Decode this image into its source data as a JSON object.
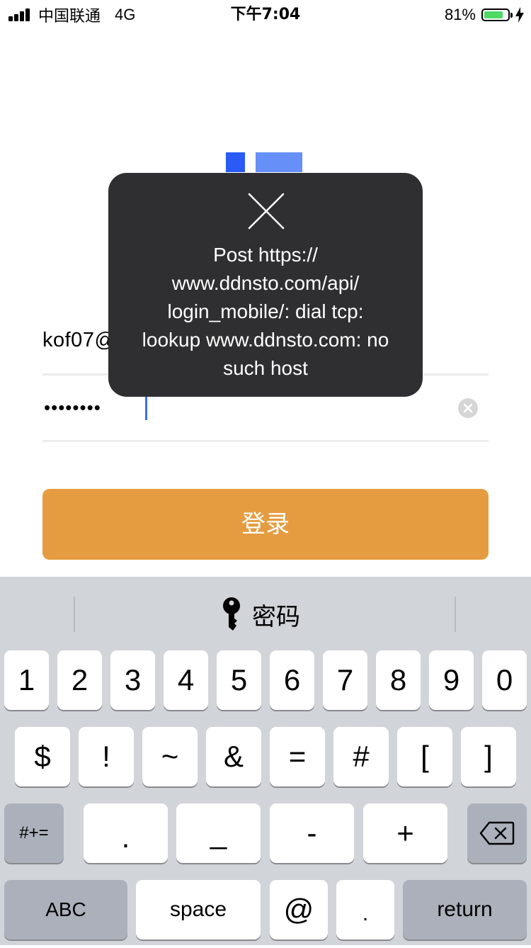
{
  "status_bar": {
    "carrier": "中国联通",
    "network": "4G",
    "time": "下午7:04",
    "battery_percent": "81%",
    "battery_level": 0.81
  },
  "form": {
    "email_value": "kof07@",
    "password_masked": "••••••••"
  },
  "login_button": {
    "label": "登录"
  },
  "toast": {
    "message": "Post https://\nwww.ddnsto.com/api/\nlogin_mobile/: dial tcp:\nlookup www.ddnsto.com: no\nsuch host"
  },
  "keyboard": {
    "hint_label": "密码",
    "row1": [
      "1",
      "2",
      "3",
      "4",
      "5",
      "6",
      "7",
      "8",
      "9",
      "0"
    ],
    "row2": [
      "$",
      "!",
      "~",
      "&",
      "=",
      "#",
      "[",
      "]"
    ],
    "row3": {
      "switch_label": "#+=",
      "keys": [
        ".",
        "_",
        "-",
        "+"
      ]
    },
    "row4": {
      "abc_label": "ABC",
      "space_label": "space",
      "at_label": "@",
      "dot_label": ".",
      "return_label": "return"
    }
  },
  "colors": {
    "login_button": "#e59c41",
    "logo_primary": "#2a5bf6",
    "logo_secondary": "#6690f8",
    "toast_bg": "#2f2f31",
    "battery_fill": "#4cd964"
  }
}
